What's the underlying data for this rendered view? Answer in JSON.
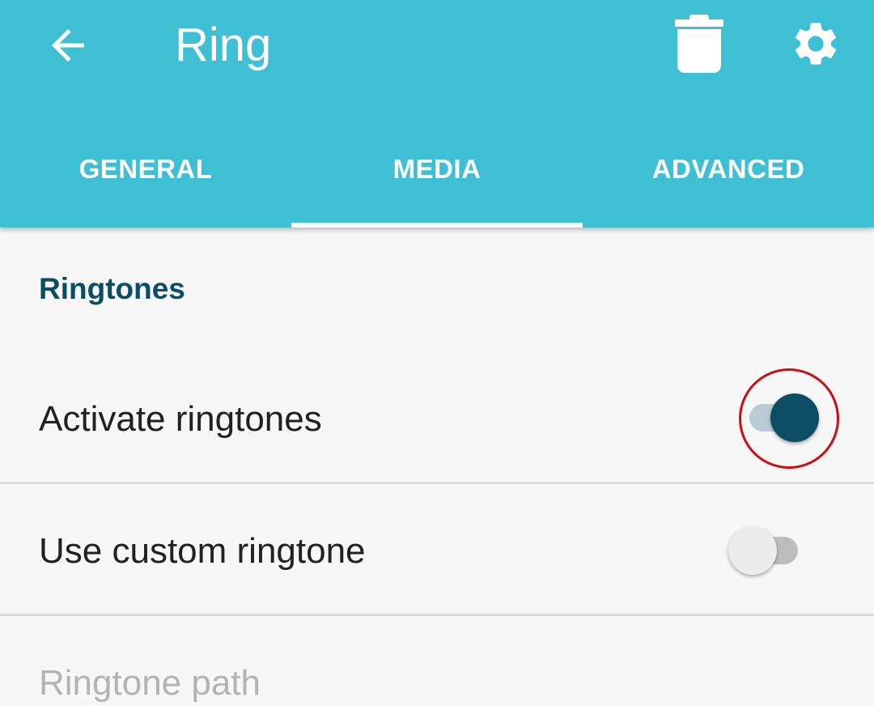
{
  "appbar": {
    "title": "Ring",
    "back_icon": "arrow-left-icon",
    "delete_icon": "trash-icon",
    "settings_icon": "gear-icon",
    "color": "#3ebfd4"
  },
  "tabs": [
    {
      "label": "GENERAL",
      "selected": false
    },
    {
      "label": "MEDIA",
      "selected": true
    },
    {
      "label": "ADVANCED",
      "selected": false
    }
  ],
  "section": {
    "title": "Ringtones"
  },
  "settings": {
    "activate_ringtones": {
      "label": "Activate ringtones",
      "enabled": true
    },
    "use_custom_ringtone": {
      "label": "Use custom ringtone",
      "enabled": false
    },
    "ringtone_path": {
      "label": "Ringtone path",
      "disabled": true
    }
  },
  "colors": {
    "accent": "#0b4d63",
    "highlight": "#cc0e14"
  }
}
